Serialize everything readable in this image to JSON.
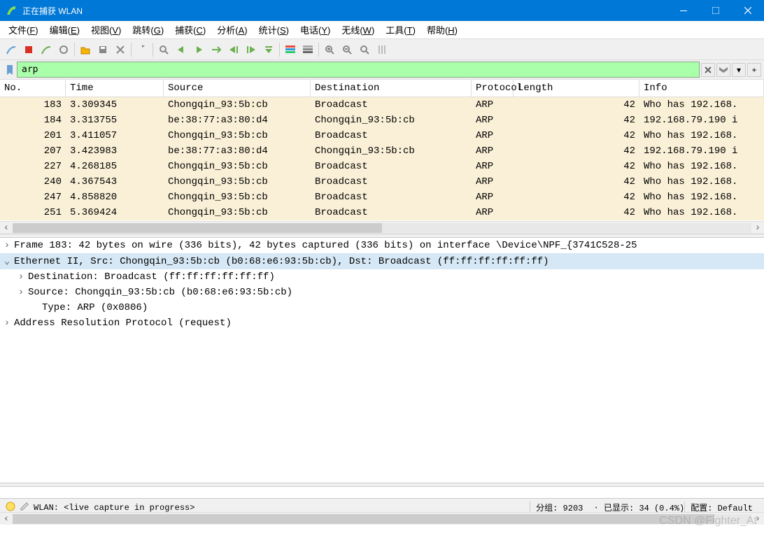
{
  "window": {
    "title": "正在捕获 WLAN"
  },
  "menu": {
    "file": "文件(F)",
    "edit": "编辑(E)",
    "view": "视图(V)",
    "go": "跳转(G)",
    "capture": "捕获(C)",
    "analyze": "分析(A)",
    "stats": "统计(S)",
    "telephony": "电话(Y)",
    "wireless": "无线(W)",
    "tools": "工具(T)",
    "help": "帮助(H)"
  },
  "filter": {
    "value": "arp"
  },
  "columns": {
    "no": "No.",
    "time": "Time",
    "source": "Source",
    "dest": "Destination",
    "proto": "Protocol",
    "length": "Length",
    "info": "Info"
  },
  "packets": [
    {
      "no": "183",
      "time": "3.309345",
      "source": "Chongqin_93:5b:cb",
      "dest": "Broadcast",
      "proto": "ARP",
      "length": "42",
      "info": "Who has 192.168.",
      "selected": true
    },
    {
      "no": "184",
      "time": "3.313755",
      "source": "be:38:77:a3:80:d4",
      "dest": "Chongqin_93:5b:cb",
      "proto": "ARP",
      "length": "42",
      "info": "192.168.79.190 i"
    },
    {
      "no": "201",
      "time": "3.411057",
      "source": "Chongqin_93:5b:cb",
      "dest": "Broadcast",
      "proto": "ARP",
      "length": "42",
      "info": "Who has 192.168."
    },
    {
      "no": "207",
      "time": "3.423983",
      "source": "be:38:77:a3:80:d4",
      "dest": "Chongqin_93:5b:cb",
      "proto": "ARP",
      "length": "42",
      "info": "192.168.79.190 i"
    },
    {
      "no": "227",
      "time": "4.268185",
      "source": "Chongqin_93:5b:cb",
      "dest": "Broadcast",
      "proto": "ARP",
      "length": "42",
      "info": "Who has 192.168."
    },
    {
      "no": "240",
      "time": "4.367543",
      "source": "Chongqin_93:5b:cb",
      "dest": "Broadcast",
      "proto": "ARP",
      "length": "42",
      "info": "Who has 192.168."
    },
    {
      "no": "247",
      "time": "4.858820",
      "source": "Chongqin_93:5b:cb",
      "dest": "Broadcast",
      "proto": "ARP",
      "length": "42",
      "info": "Who has 192.168."
    },
    {
      "no": "251",
      "time": "5.369424",
      "source": "Chongqin_93:5b:cb",
      "dest": "Broadcast",
      "proto": "ARP",
      "length": "42",
      "info": "Who has 192.168."
    }
  ],
  "details": {
    "frame": "Frame 183: 42 bytes on wire (336 bits), 42 bytes captured (336 bits) on interface \\Device\\NPF_{3741C528-25",
    "eth": "Ethernet II, Src: Chongqin_93:5b:cb (b0:68:e6:93:5b:cb), Dst: Broadcast (ff:ff:ff:ff:ff:ff)",
    "eth_dst": "Destination: Broadcast (ff:ff:ff:ff:ff:ff)",
    "eth_src": "Source: Chongqin_93:5b:cb (b0:68:e6:93:5b:cb)",
    "eth_type": "Type: ARP (0x0806)",
    "arp": "Address Resolution Protocol (request)"
  },
  "status": {
    "interface": "WLAN: <live capture in progress>",
    "packets": "分组: 9203",
    "displayed": "已显示: 34 (0.4%)",
    "profile": "配置: Default"
  },
  "watermark": "CSDN @Fighter_At"
}
